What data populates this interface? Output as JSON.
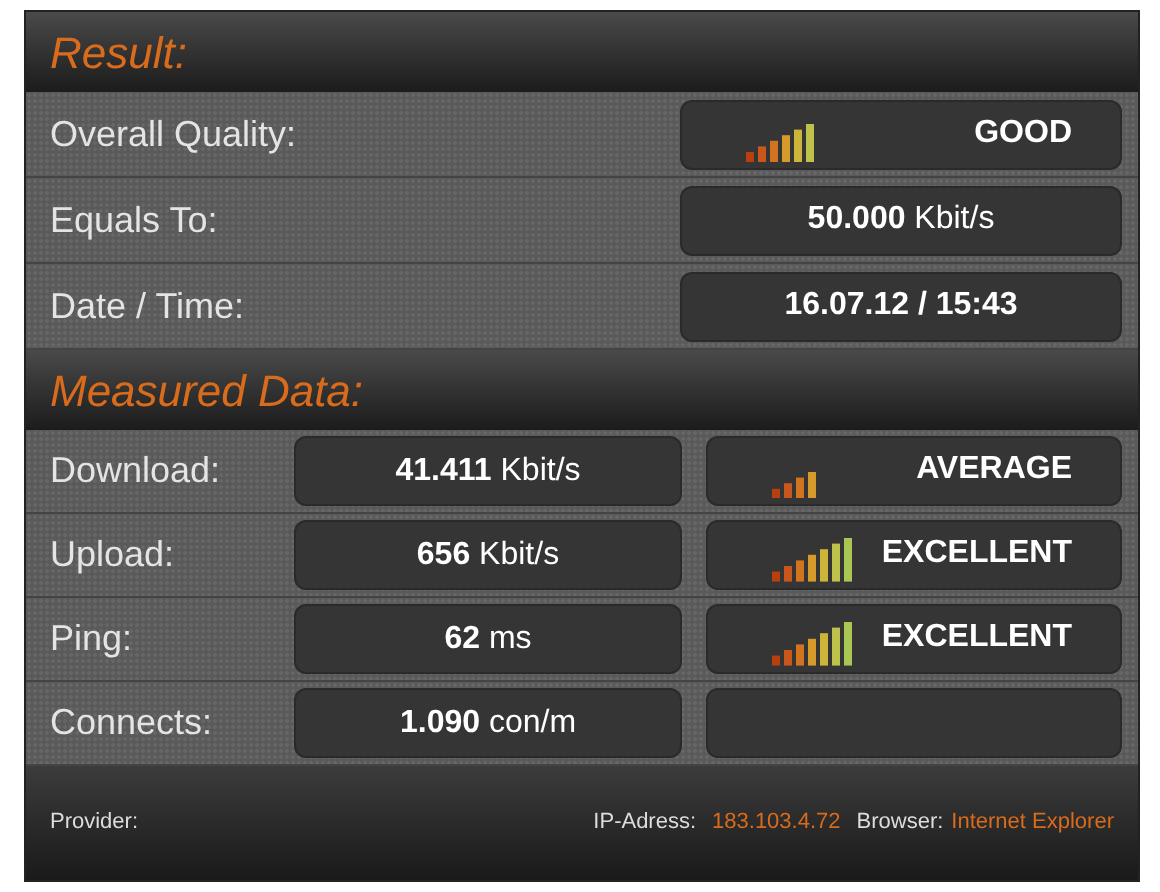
{
  "result": {
    "title": "Result:",
    "rows": [
      {
        "label": "Overall Quality:",
        "kind": "rating",
        "rating": "GOOD",
        "meter": {
          "kind": "good"
        }
      },
      {
        "label": "Equals To:",
        "kind": "value",
        "value": "**50.000** Kbit/s"
      },
      {
        "label": "Date / Time:",
        "kind": "value",
        "value": "**16.07.12 / 15:43**"
      }
    ]
  },
  "measured": {
    "title": "Measured Data:",
    "rows": [
      {
        "label": "Download:",
        "value": "**41.411** Kbit/s",
        "rating": "AVERAGE",
        "meter": {
          "kind": "average"
        }
      },
      {
        "label": "Upload:",
        "value": "**656** Kbit/s",
        "rating": "EXCELLENT",
        "meter": {
          "kind": "excellent"
        }
      },
      {
        "label": "Ping:",
        "value": "**62** ms",
        "rating": "EXCELLENT",
        "meter": {
          "kind": "excellent"
        }
      },
      {
        "label": "Connects:",
        "value": "**1.090** con/m"
      }
    ]
  },
  "footer": {
    "provider_label": "Provider:",
    "ip_label": "IP-Adress:",
    "ip": "183.103.4.72",
    "browser_label": "Browser:",
    "browser": "Internet Explorer"
  }
}
